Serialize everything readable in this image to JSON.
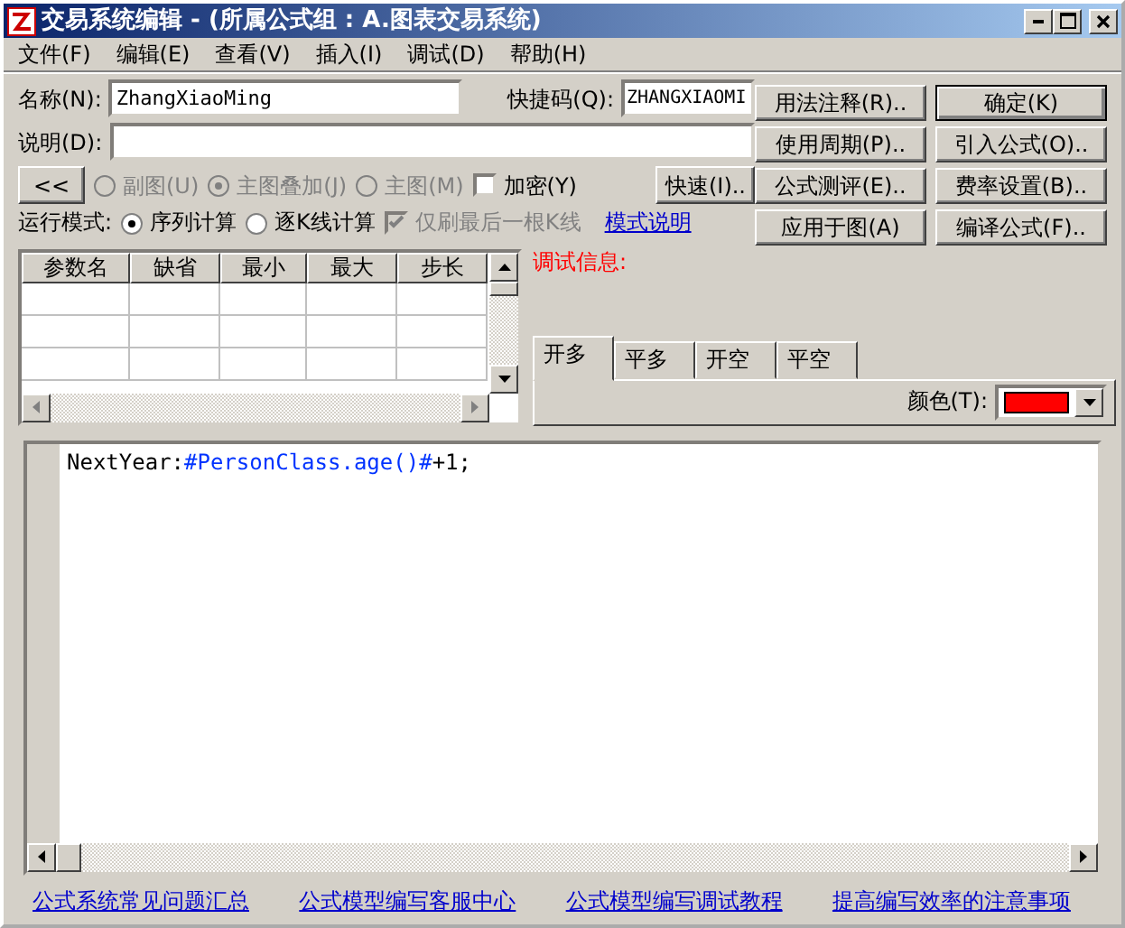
{
  "window": {
    "title": "交易系统编辑 - (所属公式组 : A.图表交易系统)"
  },
  "menu": [
    "文件(F)",
    "编辑(E)",
    "查看(V)",
    "插入(I)",
    "调试(D)",
    "帮助(H)"
  ],
  "name_field": {
    "label": "名称(N):",
    "value": "ZhangXiaoMing"
  },
  "shortcut_field": {
    "label": "快捷码(Q):",
    "value": "ZHANGXIAOMI"
  },
  "description_field": {
    "label": "说明(D):"
  },
  "collapse_button": "<<",
  "chart_options": [
    {
      "label": "副图(U)",
      "selected": false,
      "disabled": true
    },
    {
      "label": "主图叠加(J)",
      "selected": true,
      "disabled": true
    },
    {
      "label": "主图(M)",
      "selected": false,
      "disabled": true
    }
  ],
  "encrypt": {
    "label": "加密(Y)",
    "checked": false
  },
  "quick_button": "快速(I)..",
  "run_mode": {
    "label": "运行模式:",
    "options": [
      {
        "label": "序列计算",
        "selected": true
      },
      {
        "label": "逐K线计算",
        "selected": false
      }
    ],
    "refresh_last": {
      "label": "仅刷最后一根K线",
      "checked": true,
      "disabled": true
    },
    "link": "模式说明"
  },
  "buttons": [
    {
      "label": "用法注释(R)..",
      "default": false
    },
    {
      "label": "确定(K)",
      "default": true
    },
    {
      "label": "使用周期(P)..",
      "default": false
    },
    {
      "label": "引入公式(O)..",
      "default": false
    },
    {
      "label": "公式测评(E)..",
      "default": false
    },
    {
      "label": "费率设置(B)..",
      "default": false
    },
    {
      "label": "应用于图(A)",
      "default": false
    },
    {
      "label": "编译公式(F)..",
      "default": false
    }
  ],
  "params_table": {
    "columns": [
      "参数名",
      "缺省",
      "最小",
      "最大",
      "步长"
    ]
  },
  "debug_label": "调试信息:",
  "signal_tabs": [
    {
      "label": "开多",
      "selected": true
    },
    {
      "label": "平多",
      "selected": false
    },
    {
      "label": "开空",
      "selected": false
    },
    {
      "label": "平空",
      "selected": false
    }
  ],
  "color_picker": {
    "label": "颜色(T):",
    "color": "#ff0000"
  },
  "editor": {
    "segments": [
      {
        "text": "NextYear:",
        "kind": "plain"
      },
      {
        "text": "#PersonClass.age()#",
        "kind": "reference"
      },
      {
        "text": "+1;",
        "kind": "plain"
      }
    ]
  },
  "footer_links": [
    "公式系统常见问题汇总",
    "公式模型编写客服中心",
    "公式模型编写调试教程",
    "提高编写效率的注意事项"
  ]
}
